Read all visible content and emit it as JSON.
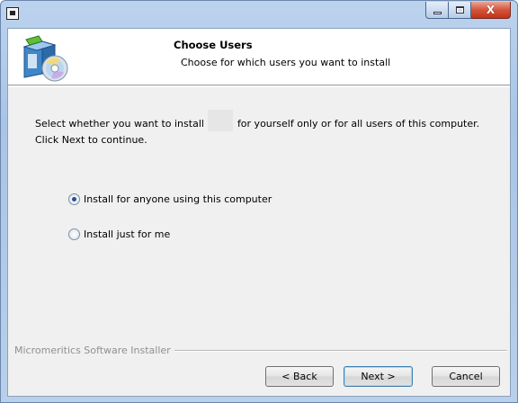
{
  "window": {
    "title": "",
    "icons": {
      "system": "installer-window-icon",
      "minimize": "minimize-icon",
      "maximize": "maximize-icon",
      "close": "close-icon"
    },
    "close_glyph": "X"
  },
  "header": {
    "title": "Choose Users",
    "subtitle": "Choose for which users you want to install",
    "icon": "installer-package-icon"
  },
  "body": {
    "description_before": "Select whether you want to install",
    "description_after": "for yourself only or for all users of this computer.",
    "description_line2": "Click Next to continue."
  },
  "options": [
    {
      "label": "Install for anyone using this computer",
      "selected": true
    },
    {
      "label": "Install just for me",
      "selected": false
    }
  ],
  "branding": "Micromeritics Software Installer",
  "buttons": {
    "back": "< Back",
    "next": "Next >",
    "cancel": "Cancel"
  },
  "colors": {
    "title_frame": "#a9c4e6",
    "close_button": "#c1331a",
    "dialog_bg": "#f0f0f0",
    "default_button_border": "#3c7fb1"
  }
}
